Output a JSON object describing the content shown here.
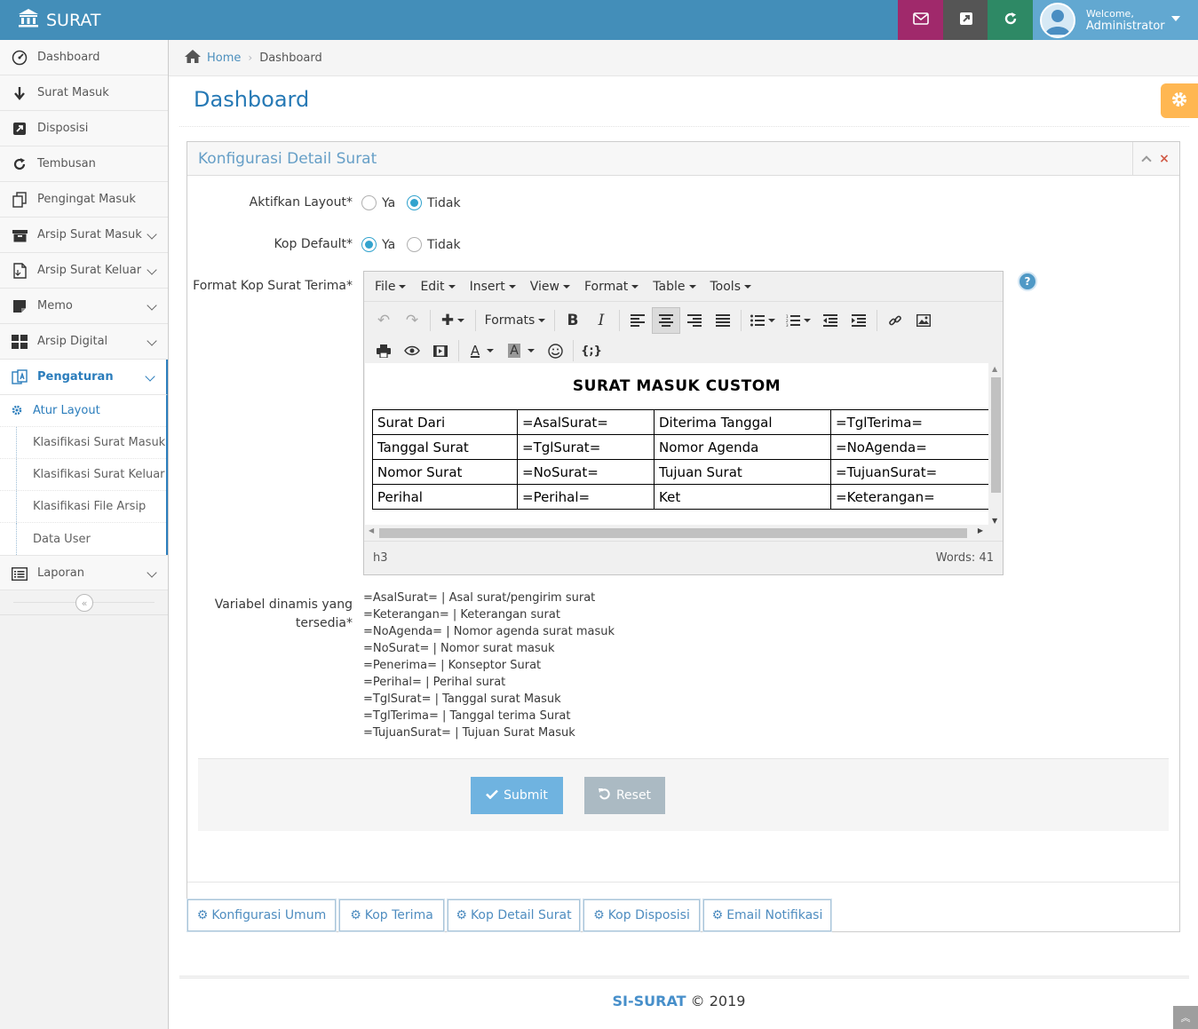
{
  "navbar": {
    "brand": "SURAT",
    "color": "#438eb9",
    "buttons": [
      {
        "icon": "envelope-icon",
        "color": "#a0296b"
      },
      {
        "icon": "external-link-icon",
        "color": "#555555"
      },
      {
        "icon": "refresh-icon",
        "color": "#2e8965"
      }
    ],
    "user": {
      "welcome": "Welcome,",
      "name": "Administrator"
    }
  },
  "sidebar": {
    "items": [
      {
        "label": "Dashboard",
        "icon": "dashboard-icon"
      },
      {
        "label": "Surat Masuk",
        "icon": "arrow-down-icon"
      },
      {
        "label": "Disposisi",
        "icon": "share-square-icon"
      },
      {
        "label": "Tembusan",
        "icon": "repeat-icon"
      },
      {
        "label": "Pengingat Masuk",
        "icon": "copy-icon"
      },
      {
        "label": "Arsip Surat Masuk",
        "icon": "archive-icon"
      },
      {
        "label": "Arsip Surat Keluar",
        "icon": "file-icon"
      },
      {
        "label": "Memo",
        "icon": "sticky-note-icon"
      },
      {
        "label": "Arsip Digital",
        "icon": "th-large-icon"
      },
      {
        "label": "Pengaturan",
        "icon": "settings-icon"
      },
      {
        "label": "Laporan",
        "icon": "list-alt-icon"
      }
    ],
    "submenu": [
      {
        "label": "Atur Layout"
      },
      {
        "label": "Klasifikasi Surat Masuk"
      },
      {
        "label": "Klasifikasi Surat Keluar"
      },
      {
        "label": "Klasifikasi File Arsip"
      },
      {
        "label": "Data User"
      }
    ]
  },
  "breadcrumb": {
    "home": "Home",
    "current": "Dashboard"
  },
  "page": {
    "title": "Dashboard"
  },
  "widget": {
    "title": "Konfigurasi Detail Surat",
    "fields": {
      "layout_label": "Aktifkan Layout*",
      "layout_options": [
        "Ya",
        "Tidak"
      ],
      "layout_selected": "Tidak",
      "kop_label": "Kop Default*",
      "kop_options": [
        "Ya",
        "Tidak"
      ],
      "kop_selected": "Ya",
      "format_label": "Format Kop Surat Terima*"
    },
    "editor": {
      "menus": [
        "File",
        "Edit",
        "Insert",
        "View",
        "Format",
        "Table",
        "Tools"
      ],
      "formats_label": "Formats",
      "heading": "SURAT MASUK CUSTOM",
      "table": [
        [
          "Surat Dari",
          "=AsalSurat=",
          "Diterima Tanggal",
          "=TglTerima="
        ],
        [
          "Tanggal Surat",
          "=TglSurat=",
          "Nomor Agenda",
          "=NoAgenda="
        ],
        [
          "Nomor Surat",
          "=NoSurat=",
          "Tujuan Surat",
          "=TujuanSurat="
        ],
        [
          "Perihal",
          "=Perihal=",
          "Ket",
          "=Keterangan="
        ]
      ],
      "path": "h3",
      "words": "Words: 41"
    },
    "vars_label_line1": "Variabel dinamis yang",
    "vars_label_line2": "tersedia*",
    "vars": [
      "=AsalSurat= | Asal surat/pengirim surat",
      "=Keterangan= | Keterangan surat",
      "=NoAgenda= | Nomor agenda surat masuk",
      "=NoSurat= | Nomor surat masuk",
      "=Penerima= | Konseptor Surat",
      "=Perihal= | Perihal surat",
      "=TglSurat= | Tanggal surat Masuk",
      "=TglTerima= | Tanggal terima Surat",
      "=TujuanSurat= | Tujuan Surat Masuk"
    ],
    "buttons": {
      "submit": "Submit",
      "reset": "Reset"
    },
    "tabs": [
      "Konfigurasi Umum",
      "Kop Terima",
      "Kop Detail Surat",
      "Kop Disposisi",
      "Email Notifikasi"
    ]
  },
  "footer": {
    "brand": "SI-SURAT",
    "text": "© 2019"
  }
}
